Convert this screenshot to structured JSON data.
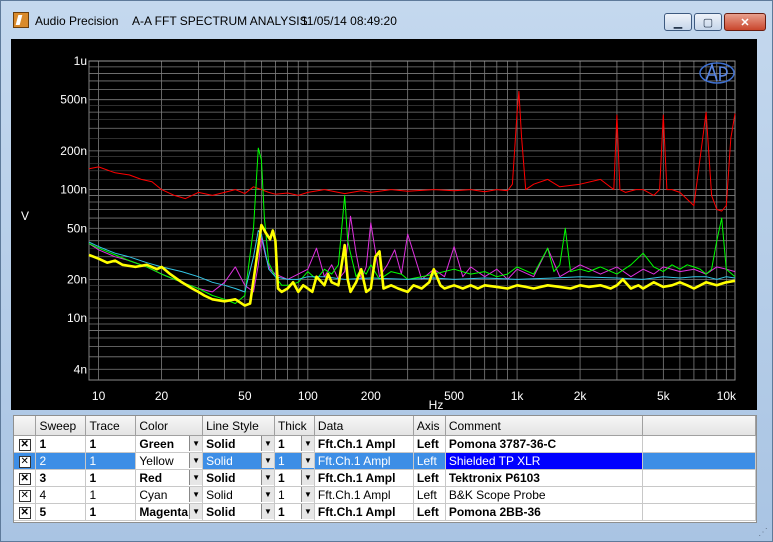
{
  "window": {
    "app": "Audio Precision",
    "title": "A-A FFT SPECTRUM ANALYSIS",
    "datetime": "11/05/14 08:49:20",
    "controls": {
      "minimize": "▁",
      "maximize": "▢",
      "close": "✕"
    }
  },
  "chart_data": {
    "type": "line",
    "xlabel": "Hz",
    "ylabel": "V",
    "xscale": "log",
    "yscale": "log",
    "xlim": [
      9,
      11000
    ],
    "ylim": [
      3.3e-09,
      1e-06
    ],
    "grid": true,
    "x_ticks": [
      {
        "v": 10,
        "l": "10"
      },
      {
        "v": 20,
        "l": "20"
      },
      {
        "v": 50,
        "l": "50"
      },
      {
        "v": 100,
        "l": "100"
      },
      {
        "v": 200,
        "l": "200"
      },
      {
        "v": 500,
        "l": "500"
      },
      {
        "v": 1000,
        "l": "1k"
      },
      {
        "v": 2000,
        "l": "2k"
      },
      {
        "v": 5000,
        "l": "5k"
      },
      {
        "v": 10000,
        "l": "10k"
      }
    ],
    "y_ticks": [
      {
        "v": 1e-06,
        "l": "1u"
      },
      {
        "v": 5e-07,
        "l": "500n"
      },
      {
        "v": 2e-07,
        "l": "200n"
      },
      {
        "v": 1e-07,
        "l": "100n"
      },
      {
        "v": 5e-08,
        "l": "50n"
      },
      {
        "v": 2e-08,
        "l": "20n"
      },
      {
        "v": 1e-08,
        "l": "10n"
      },
      {
        "v": 4e-09,
        "l": "4n"
      }
    ],
    "series": [
      {
        "name": "Pomona 3787-36-C",
        "color": "#00ff00",
        "width": 1,
        "x": [
          9,
          10,
          12,
          14,
          17,
          20,
          25,
          30,
          35,
          40,
          45,
          50,
          55,
          58,
          60,
          62,
          65,
          70,
          75,
          80,
          90,
          100,
          110,
          120,
          130,
          140,
          150,
          155,
          160,
          170,
          180,
          190,
          200,
          220,
          250,
          280,
          300,
          350,
          400,
          500,
          600,
          700,
          800,
          900,
          1000,
          1200,
          1400,
          1500,
          1600,
          1700,
          1800,
          2000,
          2200,
          2500,
          3000,
          3500,
          4000,
          4500,
          5000,
          5500,
          6000,
          6500,
          7000,
          7500,
          8000,
          8500,
          9000,
          9500,
          10000,
          11000
        ],
        "y": [
          3.8e-08,
          3.5e-08,
          3.1e-08,
          2.8e-08,
          2.5e-08,
          2.2e-08,
          1.9e-08,
          1.7e-08,
          1.5e-08,
          1.4e-08,
          1.3e-08,
          1.5e-08,
          5e-08,
          2.1e-07,
          1.7e-07,
          6e-08,
          2.7e-08,
          2.1e-08,
          1.8e-08,
          1.8e-08,
          1.9e-08,
          2.3e-08,
          2e-08,
          2.4e-08,
          2.2e-08,
          2.6e-08,
          9e-08,
          4e-08,
          3.2e-08,
          2.1e-08,
          2.4e-08,
          2.2e-08,
          2.6e-08,
          2e-08,
          2.3e-08,
          2.2e-08,
          2e-08,
          2.1e-08,
          2.2e-08,
          2.4e-08,
          2.2e-08,
          2.3e-08,
          2.1e-08,
          2.2e-08,
          2.5e-08,
          2.2e-08,
          3.5e-08,
          2.3e-08,
          2.6e-08,
          5e-08,
          2.3e-08,
          2.4e-08,
          2.3e-08,
          2.5e-08,
          2.2e-08,
          2.6e-08,
          3.2e-08,
          2.5e-08,
          2.3e-08,
          2.6e-08,
          2.4e-08,
          2.6e-08,
          2.5e-08,
          2.4e-08,
          2.2e-08,
          2.4e-08,
          4e-08,
          6e-08,
          2.4e-08,
          2.1e-08
        ]
      },
      {
        "name": "Shielded TP XLR",
        "color": "#ffff00",
        "width": 2.6,
        "x": [
          9,
          10,
          11,
          12,
          13,
          15,
          17,
          19,
          20,
          22,
          25,
          28,
          30,
          32,
          35,
          40,
          45,
          50,
          53,
          56,
          60,
          63,
          66,
          68,
          70,
          72,
          75,
          80,
          85,
          90,
          95,
          100,
          105,
          110,
          120,
          125,
          130,
          140,
          150,
          155,
          160,
          170,
          180,
          190,
          200,
          210,
          220,
          230,
          250,
          270,
          300,
          320,
          350,
          380,
          400,
          430,
          450,
          500,
          550,
          600,
          650,
          700,
          800,
          900,
          1000,
          1100,
          1200,
          1400,
          1600,
          1800,
          2000,
          2200,
          2500,
          2800,
          3000,
          3200,
          3500,
          3800,
          4000,
          4500,
          5000,
          5500,
          6000,
          6500,
          7000,
          8000,
          9000,
          10000,
          11000
        ],
        "y": [
          3.1e-08,
          2.9e-08,
          2.7e-08,
          2.8e-08,
          2.6e-08,
          2.5e-08,
          2.6e-08,
          2.4e-08,
          2.5e-08,
          2.2e-08,
          1.9e-08,
          1.7e-08,
          1.6e-08,
          1.5e-08,
          1.4e-08,
          1.35e-08,
          1.4e-08,
          1.25e-08,
          1.3e-08,
          2.4e-08,
          5.3e-08,
          4.6e-08,
          4.1e-08,
          4.8e-08,
          4e-08,
          1.7e-08,
          1.6e-08,
          1.7e-08,
          1.9e-08,
          1.6e-08,
          1.8e-08,
          1.7e-08,
          1.6e-08,
          2.1e-08,
          1.8e-08,
          2.2e-08,
          1.9e-08,
          1.8e-08,
          3.7e-08,
          2e-08,
          1.6e-08,
          1.9e-08,
          2.4e-08,
          1.6e-08,
          1.7e-08,
          3e-08,
          3.3e-08,
          1.7e-08,
          1.8e-08,
          1.7e-08,
          1.6e-08,
          1.8e-08,
          1.7e-08,
          1.9e-08,
          2.4e-08,
          1.8e-08,
          1.7e-08,
          1.8e-08,
          1.7e-08,
          1.8e-08,
          1.7e-08,
          1.8e-08,
          1.75e-08,
          1.7e-08,
          1.8e-08,
          1.75e-08,
          1.7e-08,
          1.8e-08,
          1.75e-08,
          1.7e-08,
          1.8e-08,
          1.75e-08,
          1.8e-08,
          1.7e-08,
          1.8e-08,
          2e-08,
          1.7e-08,
          1.8e-08,
          1.7e-08,
          1.9e-08,
          1.75e-08,
          1.8e-08,
          1.9e-08,
          1.8e-08,
          1.7e-08,
          1.9e-08,
          1.8e-08,
          1.9e-08,
          1.95e-08
        ]
      },
      {
        "name": "Tektronix P6103",
        "color": "#ff0000",
        "width": 1,
        "x": [
          9,
          10,
          12,
          14,
          16,
          18,
          20,
          23,
          26,
          30,
          35,
          40,
          45,
          50,
          55,
          60,
          65,
          70,
          80,
          90,
          100,
          120,
          150,
          180,
          200,
          250,
          300,
          400,
          500,
          600,
          700,
          800,
          900,
          950,
          1000,
          1020,
          1050,
          1100,
          1200,
          1400,
          1600,
          2000,
          2500,
          2900,
          3000,
          3100,
          3300,
          3700,
          4000,
          4500,
          4800,
          5000,
          5200,
          5500,
          6000,
          7000,
          8000,
          8500,
          9000,
          9500,
          10000,
          10500,
          11000
        ],
        "y": [
          1.45e-07,
          1.5e-07,
          1.35e-07,
          1.3e-07,
          1.2e-07,
          1.15e-07,
          1e-07,
          9e-08,
          8.5e-08,
          9.5e-08,
          9e-08,
          9.5e-08,
          1e-07,
          9.3e-08,
          1.05e-07,
          1e-07,
          9.5e-08,
          9.2e-08,
          9.4e-08,
          9e-08,
          9.5e-08,
          1e-07,
          9.3e-08,
          9.8e-08,
          9.5e-08,
          1e-07,
          9.7e-08,
          1e-07,
          9.8e-08,
          1e-07,
          9.6e-08,
          1e-07,
          9.8e-08,
          1.1e-07,
          4e-07,
          5.8e-07,
          2.6e-07,
          1e-07,
          1.1e-07,
          1.2e-07,
          1.05e-07,
          1.1e-07,
          1.2e-07,
          1e-07,
          3.8e-07,
          1e-07,
          9.5e-08,
          1e-07,
          1e-07,
          9e-08,
          1e-07,
          3.8e-07,
          1e-07,
          1e-07,
          9.5e-08,
          7.5e-08,
          4e-07,
          9e-08,
          7e-08,
          6.8e-08,
          7.5e-08,
          2.5e-07,
          3.9e-07
        ]
      },
      {
        "name": "B&K Scope Probe",
        "color": "#33c6e6",
        "width": 1,
        "x": [
          9,
          10,
          12,
          14,
          17,
          20,
          25,
          30,
          35,
          40,
          45,
          50,
          55,
          58,
          60,
          62,
          65,
          70,
          80,
          90,
          100,
          120,
          150,
          200,
          300,
          400,
          500,
          700,
          1000,
          1500,
          2000,
          3000,
          4000,
          5000,
          6000,
          7000,
          8000,
          9000,
          10000,
          11000
        ],
        "y": [
          3.9e-08,
          3.6e-08,
          3.2e-08,
          3e-08,
          2.7e-08,
          2.5e-08,
          2.3e-08,
          2.1e-08,
          1.9e-08,
          1.8e-08,
          1.7e-08,
          1.6e-08,
          3e-08,
          4.8e-08,
          4.5e-08,
          3.5e-08,
          2.4e-08,
          2.1e-08,
          2e-08,
          2e-08,
          2.1e-08,
          2.1e-08,
          2e-08,
          2.05e-08,
          2e-08,
          2.05e-08,
          2e-08,
          2.05e-08,
          2e-08,
          2.05e-08,
          2.1e-08,
          2.05e-08,
          2e-08,
          2.1e-08,
          2.05e-08,
          2.1e-08,
          2.1e-08,
          2e-08,
          2.1e-08,
          2.05e-08
        ]
      },
      {
        "name": "Pomona 2BB-36",
        "color": "#e030e0",
        "width": 1,
        "x": [
          9,
          10,
          12,
          14,
          17,
          20,
          25,
          30,
          35,
          40,
          45,
          50,
          55,
          58,
          60,
          63,
          66,
          70,
          80,
          90,
          100,
          110,
          120,
          130,
          140,
          150,
          160,
          170,
          180,
          190,
          200,
          220,
          240,
          260,
          280,
          300,
          350,
          400,
          450,
          500,
          550,
          600,
          700,
          800,
          900,
          1000,
          1200,
          1400,
          1600,
          2000,
          2500,
          3000,
          3500,
          4000,
          4500,
          5000,
          6000,
          7000,
          8000,
          9000,
          10000,
          11000
        ],
        "y": [
          3.8e-08,
          3.4e-08,
          3e-08,
          2.8e-08,
          2.5e-08,
          2.2e-08,
          1.9e-08,
          1.7e-08,
          1.6e-08,
          1.9e-08,
          2.5e-08,
          1.8e-08,
          1.6e-08,
          2.6e-08,
          4.2e-08,
          3e-08,
          2.4e-08,
          2.2e-08,
          2e-08,
          2.2e-08,
          2.4e-08,
          3.5e-08,
          2.1e-08,
          2.6e-08,
          2e-08,
          2.3e-08,
          6.2e-08,
          3.2e-08,
          2e-08,
          2.5e-08,
          5.5e-08,
          2.1e-08,
          2.6e-08,
          3.4e-08,
          2.2e-08,
          4.5e-08,
          2e-08,
          2.4e-08,
          2.1e-08,
          3.6e-08,
          2.1e-08,
          2.5e-08,
          2.1e-08,
          2.4e-08,
          2e-08,
          2.4e-08,
          2.1e-08,
          3.5e-08,
          2.1e-08,
          2.6e-08,
          2.2e-08,
          2.5e-08,
          2.1e-08,
          2.4e-08,
          2.2e-08,
          2.5e-08,
          2.3e-08,
          2.4e-08,
          2.2e-08,
          2.5e-08,
          2.4e-08,
          2.3e-08
        ]
      }
    ]
  },
  "table": {
    "headers": [
      "Sweep",
      "Trace",
      "Color",
      "Line Style",
      "Thick",
      "Data",
      "Axis",
      "Comment"
    ],
    "rows": [
      {
        "checked": "✕",
        "sweep": "1",
        "trace": "1",
        "color": "Green",
        "style": "Solid",
        "thick": "1",
        "data": "Fft.Ch.1 Ampl",
        "axis": "Left",
        "comment": "Pomona 3787-36-C"
      },
      {
        "checked": "✕",
        "sweep": "2",
        "trace": "1",
        "color": "Yellow",
        "style": "Solid",
        "thick": "1",
        "data": "Fft.Ch.1 Ampl",
        "axis": "Left",
        "comment": "Shielded TP XLR"
      },
      {
        "checked": "✕",
        "sweep": "3",
        "trace": "1",
        "color": "Red",
        "style": "Solid",
        "thick": "1",
        "data": "Fft.Ch.1 Ampl",
        "axis": "Left",
        "comment": "Tektronix P6103"
      },
      {
        "checked": "✕",
        "sweep": "4",
        "trace": "1",
        "color": "Cyan",
        "style": "Solid",
        "thick": "1",
        "data": "Fft.Ch.1 Ampl",
        "axis": "Left",
        "comment": "B&K Scope Probe"
      },
      {
        "checked": "✕",
        "sweep": "5",
        "trace": "1",
        "color": "Magenta",
        "style": "Solid",
        "thick": "1",
        "data": "Fft.Ch.1 Ampl",
        "axis": "Left",
        "comment": "Pomona 2BB-36"
      }
    ]
  }
}
